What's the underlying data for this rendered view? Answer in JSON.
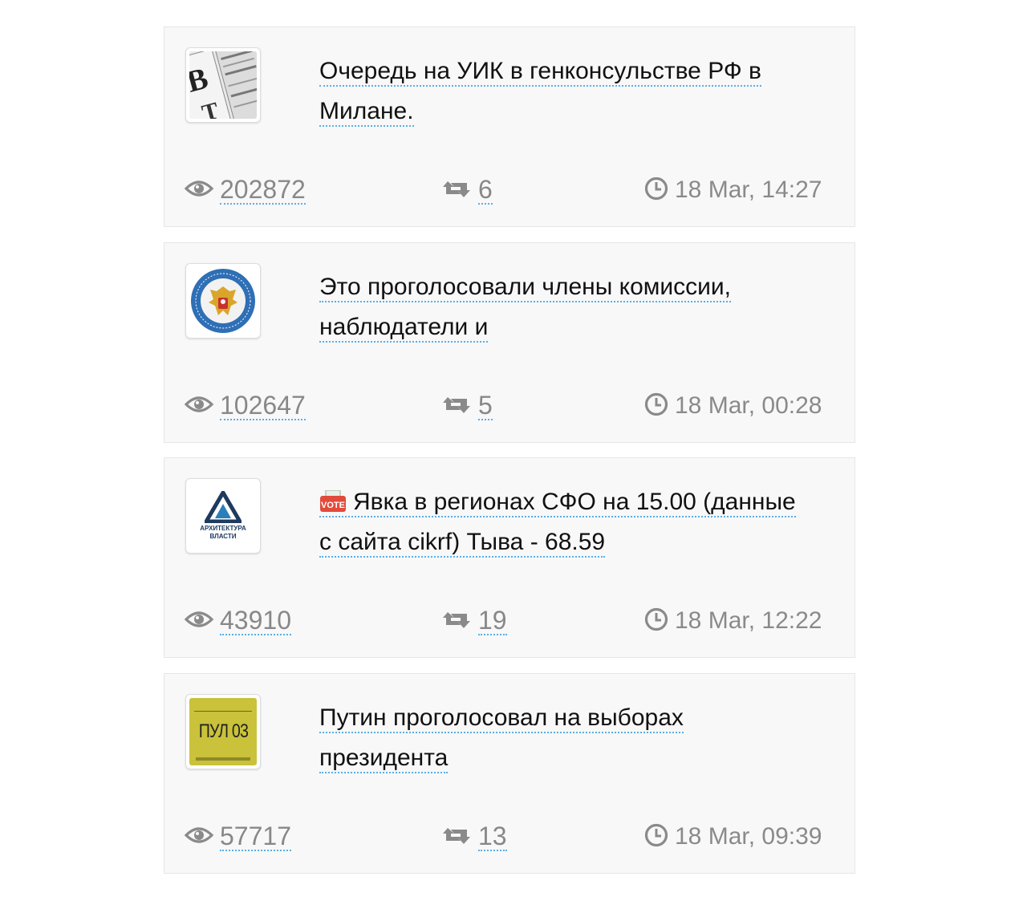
{
  "posts": [
    {
      "title": "Очередь на УИК в генконсульстве РФ в Милане.",
      "views": "202872",
      "reposts": "6",
      "time": "18 Mar, 14:27",
      "thumb_icon": "newspaper-thumbnail",
      "vote_badge": false
    },
    {
      "title": "Это проголосовали члены комиссии, наблюдатели и",
      "views": "102647",
      "reposts": "5",
      "time": "18 Mar, 00:28",
      "thumb_icon": "election-commission-emblem"
    },
    {
      "title": "Явка в регионах СФО на 15.00 (данные с сайта cikrf) Тыва - 68.59",
      "views": "43910",
      "reposts": "19",
      "time": "18 Mar, 12:22",
      "thumb_icon": "architecture-of-power-logo",
      "thumb_text": "АРХИТЕКТУРА ВЛАСТИ",
      "vote_badge_text": "VOTE"
    },
    {
      "title": "Путин проголосовал на выборах президента",
      "views": "57717",
      "reposts": "13",
      "time": "18 Mar, 09:39",
      "thumb_icon": "press-pool-badge",
      "thumb_text": "ПУЛ 03"
    }
  ],
  "colors": {
    "card_bg": "#f8f8f8",
    "link_underline": "#5aaee8",
    "meta_text": "#8a8a8a",
    "vote_red": "#e24a3b"
  }
}
